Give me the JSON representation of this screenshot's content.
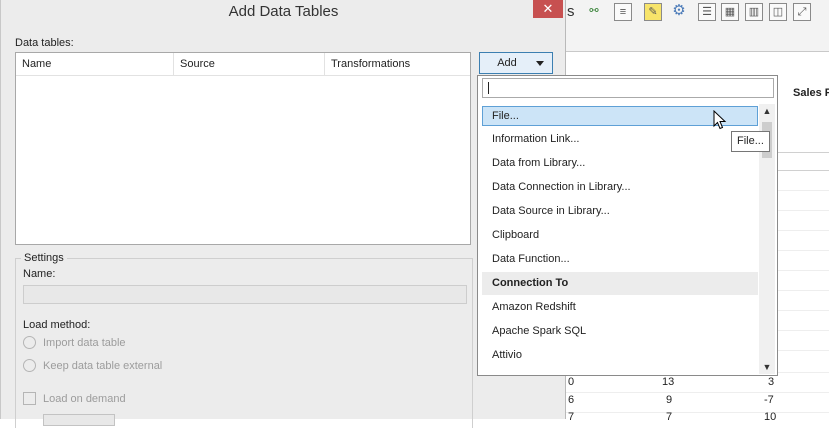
{
  "background_app": {
    "toolbar_text": "s",
    "column_header": "Sales F",
    "rows": [
      {
        "c1": "0",
        "c2": "13",
        "c3": "3"
      },
      {
        "c1": "6",
        "c2": "9",
        "c3": "-7"
      },
      {
        "c1": "7",
        "c2": "7",
        "c3": "10"
      }
    ]
  },
  "dialog": {
    "title": "Add Data Tables",
    "close_symbol": "✕",
    "data_tables_label": "Data tables:",
    "columns": [
      "Name",
      "Source",
      "Transformations"
    ],
    "add_button": "Add",
    "settings": {
      "legend": "Settings",
      "name_label": "Name:",
      "name_value": "",
      "load_method_label": "Load method:",
      "options": [
        "Import data table",
        "Keep data table external"
      ],
      "load_on_demand": "Load on demand"
    }
  },
  "dropdown": {
    "search_value": "",
    "items": [
      {
        "label": "File...",
        "type": "item",
        "selected": true
      },
      {
        "label": "Information Link...",
        "type": "item"
      },
      {
        "label": "Data from Library...",
        "type": "item"
      },
      {
        "label": "Data Connection in Library...",
        "type": "item"
      },
      {
        "label": "Data Source in Library...",
        "type": "item"
      },
      {
        "label": "Clipboard",
        "type": "item"
      },
      {
        "label": "Data Function...",
        "type": "item"
      },
      {
        "label": "Connection To",
        "type": "group"
      },
      {
        "label": "Amazon Redshift",
        "type": "item"
      },
      {
        "label": "Apache Spark SQL",
        "type": "item"
      },
      {
        "label": "Attivio",
        "type": "item"
      }
    ],
    "tooltip": "File..."
  },
  "colors": {
    "close": "#c75050",
    "selection": "#cce4f7",
    "selection_border": "#5ea0d6",
    "button_border": "#3c7fb1"
  }
}
